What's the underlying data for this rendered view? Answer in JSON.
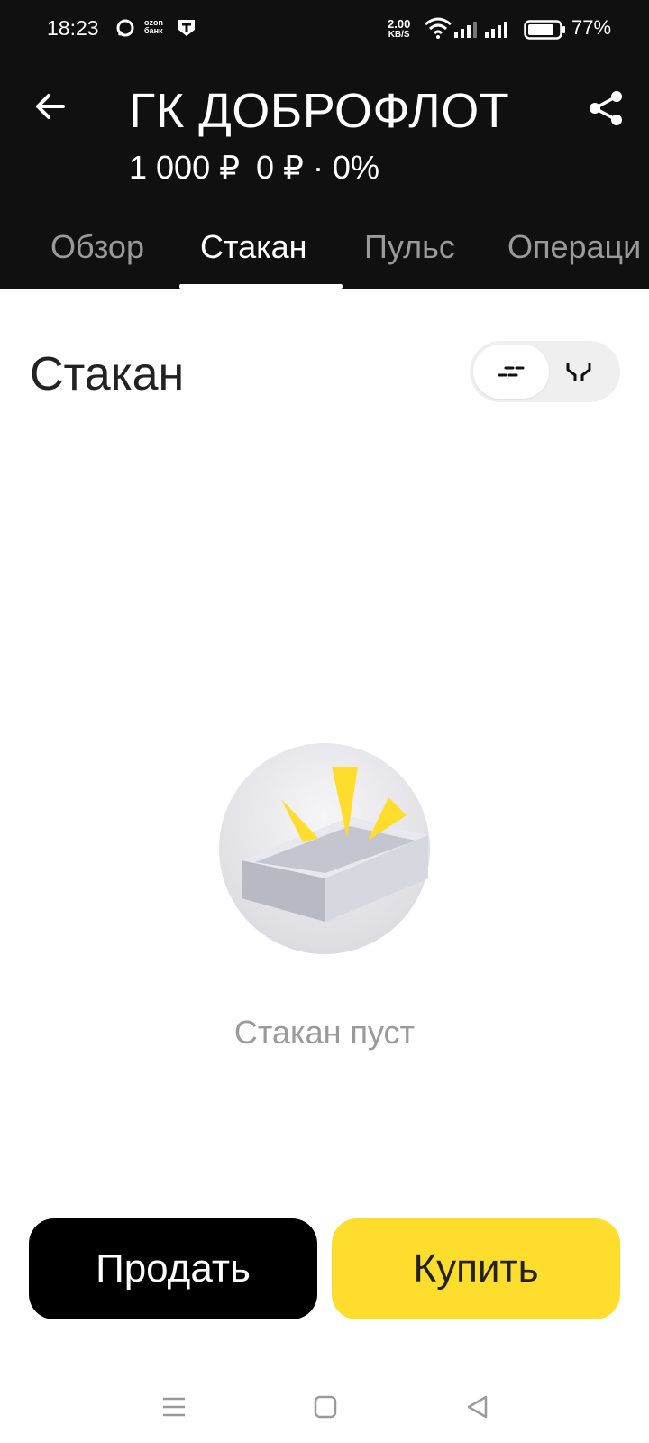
{
  "status_bar": {
    "time": "18:23",
    "net_speed_value": "2.00",
    "net_speed_unit": "KB/S",
    "battery": "77%",
    "icons": [
      "chat-icon",
      "ozon-bank-icon",
      "tbank-icon",
      "wifi-icon",
      "signal-icon",
      "battery-icon"
    ],
    "ozon_label_1": "ozon",
    "ozon_label_2": "банк"
  },
  "header": {
    "title": "ГК ДОБРОФЛОТ",
    "price": "1 000 ₽",
    "change": "0 ₽ · 0%"
  },
  "tabs": [
    {
      "label": "Обзор",
      "active": false
    },
    {
      "label": "Стакан",
      "active": true
    },
    {
      "label": "Пульс",
      "active": false
    },
    {
      "label": "Операци",
      "active": false
    }
  ],
  "orderbook": {
    "title": "Стакан",
    "empty_text": "Стакан пуст",
    "view_toggle": [
      "list-view-icon",
      "depth-chart-icon"
    ],
    "selected_view": "list-view-icon"
  },
  "actions": {
    "sell_label": "Продать",
    "buy_label": "Купить"
  },
  "colors": {
    "header_bg": "#101010",
    "buy": "#ffdd2d",
    "sell": "#000000",
    "muted_text": "#9a9a9a"
  },
  "nav": [
    "menu-icon",
    "home-icon",
    "back-icon"
  ]
}
